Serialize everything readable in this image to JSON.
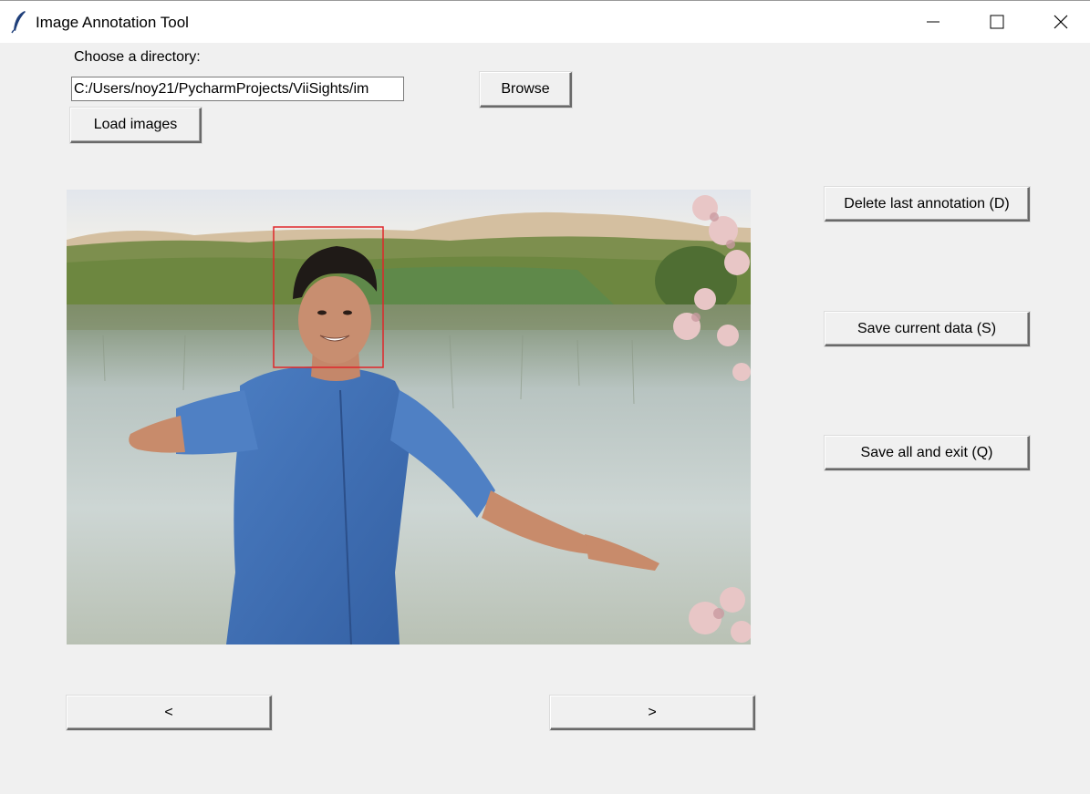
{
  "window": {
    "title": "Image Annotation Tool",
    "minimize_icon": "minimize-icon",
    "maximize_icon": "maximize-icon",
    "close_icon": "close-icon"
  },
  "directory": {
    "label": "Choose a directory:",
    "path_value": "C:/Users/noy21/PycharmProjects/ViiSights/im",
    "browse_label": "Browse",
    "load_label": "Load images"
  },
  "actions": {
    "delete_label": "Delete last annotation (D)",
    "save_current_label": "Save current data (S)",
    "save_exit_label": "Save all and exit (Q)"
  },
  "navigation": {
    "prev_label": "<",
    "next_label": ">"
  },
  "canvas": {
    "annotation_color": "#e0262a",
    "annotation_count": 1
  },
  "colors": {
    "background": "#f0f0f0",
    "titlebar": "#ffffff"
  }
}
